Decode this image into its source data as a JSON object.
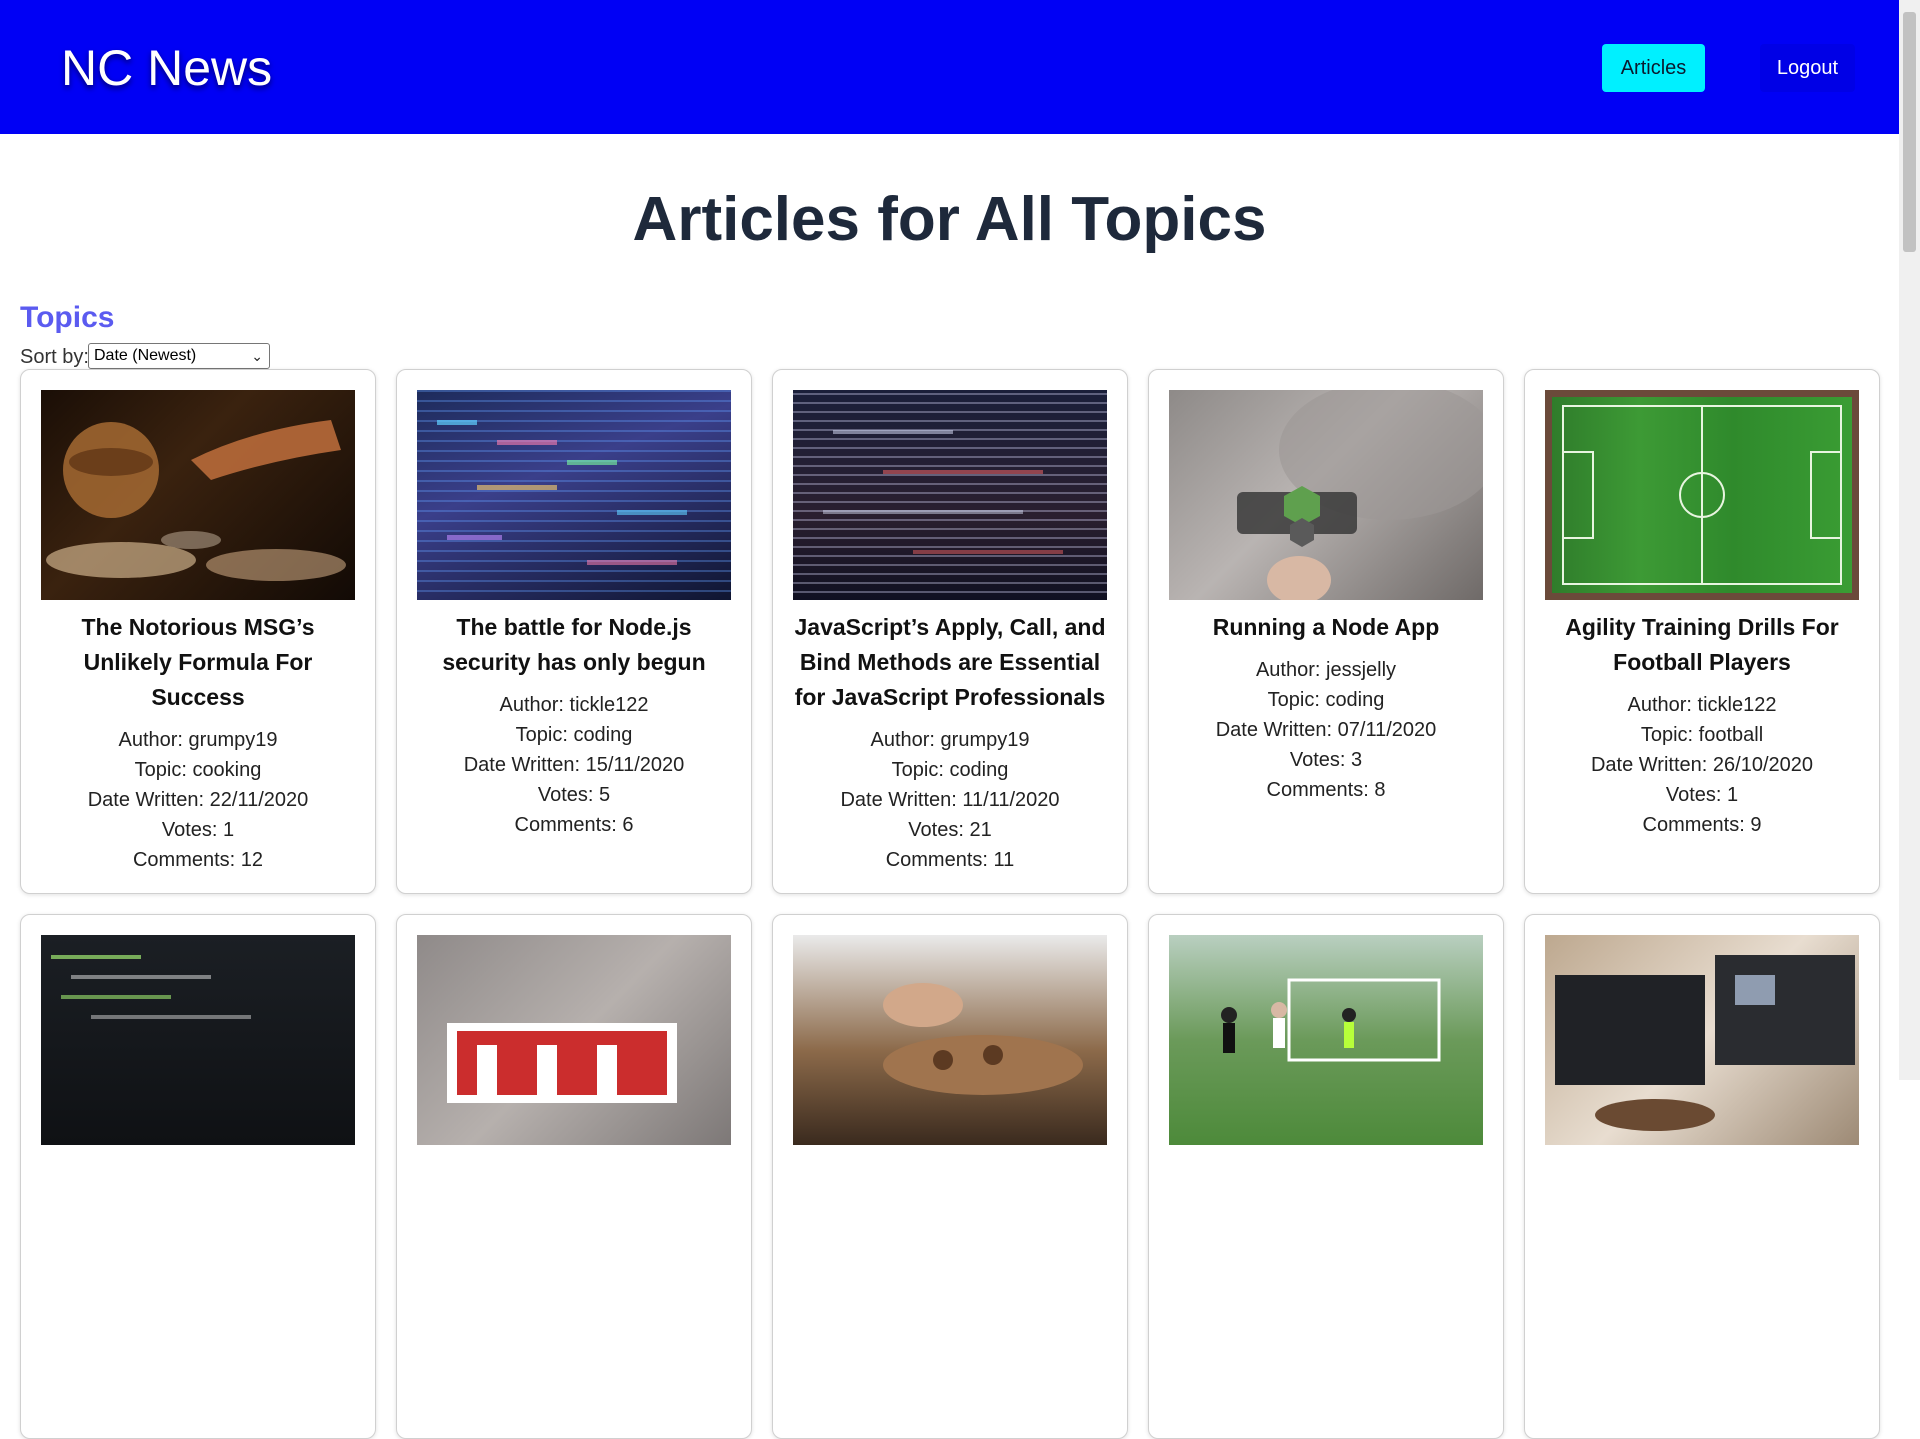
{
  "header": {
    "brand": "NC News",
    "nav_articles": "Articles",
    "nav_logout": "Logout"
  },
  "page_title": "Articles for All Topics",
  "topics_heading": "Topics",
  "sort": {
    "label": "Sort by:",
    "selected": "Date (Newest)"
  },
  "labels": {
    "author": "Author: ",
    "topic": "Topic: ",
    "date": "Date Written: ",
    "votes": "Votes: ",
    "comments": "Comments: "
  },
  "articles": [
    {
      "title": "The Notorious MSG’s Unlikely Formula For Success",
      "author": "grumpy19",
      "topic": "cooking",
      "date": "22/11/2020",
      "votes": "1",
      "comments": "12"
    },
    {
      "title": "The battle for Node.js security has only begun",
      "author": "tickle122",
      "topic": "coding",
      "date": "15/11/2020",
      "votes": "5",
      "comments": "6"
    },
    {
      "title": "JavaScript’s Apply, Call, and Bind Methods are Essential for JavaScript Professionals",
      "author": "grumpy19",
      "topic": "coding",
      "date": "11/11/2020",
      "votes": "21",
      "comments": "11"
    },
    {
      "title": "Running a Node App",
      "author": "jessjelly",
      "topic": "coding",
      "date": "07/11/2020",
      "votes": "3",
      "comments": "8"
    },
    {
      "title": "Agility Training Drills For Football Players",
      "author": "tickle122",
      "topic": "football",
      "date": "26/10/2020",
      "votes": "1",
      "comments": "9"
    }
  ],
  "colors": {
    "header_bg": "#0000f5",
    "articles_button": "#00f0ff",
    "topics_heading": "#5b5bf0",
    "title_text": "#1e293b"
  }
}
